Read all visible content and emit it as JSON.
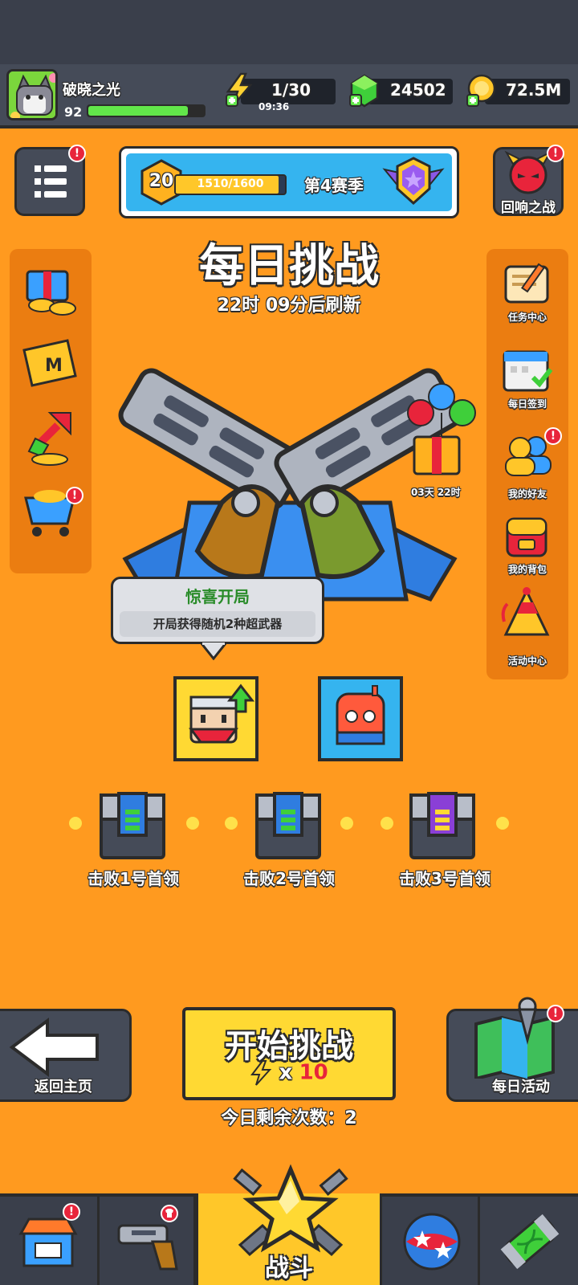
{
  "colors": {
    "background": "#ff9a1f",
    "panel": "#454b58",
    "accent_yellow": "#ffd933",
    "badge_red": "#e8243b",
    "xp_green": "#62e64a"
  },
  "player": {
    "name": "破晓之光",
    "level": "92",
    "xp_fraction": 0.86
  },
  "resources": {
    "energy": {
      "value": "1/30",
      "timer": "09:36",
      "icon": "lightning-plus-icon"
    },
    "gems": {
      "value": "24502",
      "icon": "green-gem-icon"
    },
    "coins": {
      "value": "72.5M",
      "icon": "gold-coin-icon"
    }
  },
  "season": {
    "level": "20",
    "progress_text": "1510/1600",
    "progress_fraction": 0.944,
    "label": "第4赛季"
  },
  "echo_battle": {
    "label": "回响之战"
  },
  "challenge": {
    "title": "每日挑战",
    "refresh": "22时 09分后刷新"
  },
  "right_rail": [
    {
      "key": "tasks",
      "label": "任务中心",
      "icon": "scroll-icon"
    },
    {
      "key": "signin",
      "label": "每日签到",
      "icon": "calendar-icon"
    },
    {
      "key": "friends",
      "label": "我的好友",
      "icon": "friends-icon",
      "badge": "!"
    },
    {
      "key": "backpack",
      "label": "我的背包",
      "icon": "backpack-icon"
    },
    {
      "key": "events",
      "label": "活动中心",
      "icon": "party-hat-icon"
    }
  ],
  "gift": {
    "countdown": "03天 22时"
  },
  "tooltip": {
    "title": "惊喜开局",
    "body": "开局获得随机2种超武器"
  },
  "bosses": [
    {
      "label": "击败1号首领"
    },
    {
      "label": "击败2号首领"
    },
    {
      "label": "击败3号首领"
    }
  ],
  "buttons": {
    "back": "返回主页",
    "start": "开始挑战",
    "cost_prefix": "x",
    "cost_value": "10",
    "daily": "每日活动"
  },
  "remaining": "今日剩余次数：2",
  "tabs": {
    "battle": "战斗"
  },
  "badge_symbol": "!"
}
